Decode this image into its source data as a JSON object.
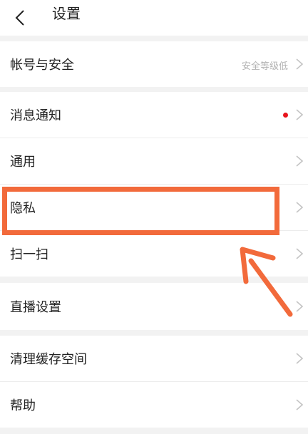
{
  "header": {
    "title": "设置"
  },
  "menu": {
    "account_security": {
      "label": "帐号与安全",
      "status": "安全等级低"
    },
    "notifications": {
      "label": "消息通知"
    },
    "general": {
      "label": "通用"
    },
    "privacy": {
      "label": "隐私"
    },
    "scan": {
      "label": "扫一扫"
    },
    "live_settings": {
      "label": "直播设置"
    },
    "clear_cache": {
      "label": "清理缓存空间"
    },
    "help": {
      "label": "帮助"
    }
  },
  "annotation": {
    "highlight_color": "#f26a3b",
    "highlighted_item": "隐私"
  },
  "colors": {
    "background": "#f2f2f2",
    "row": "#ffffff",
    "unread_dot": "#e8141c",
    "secondary_text": "#b3b3b3"
  }
}
